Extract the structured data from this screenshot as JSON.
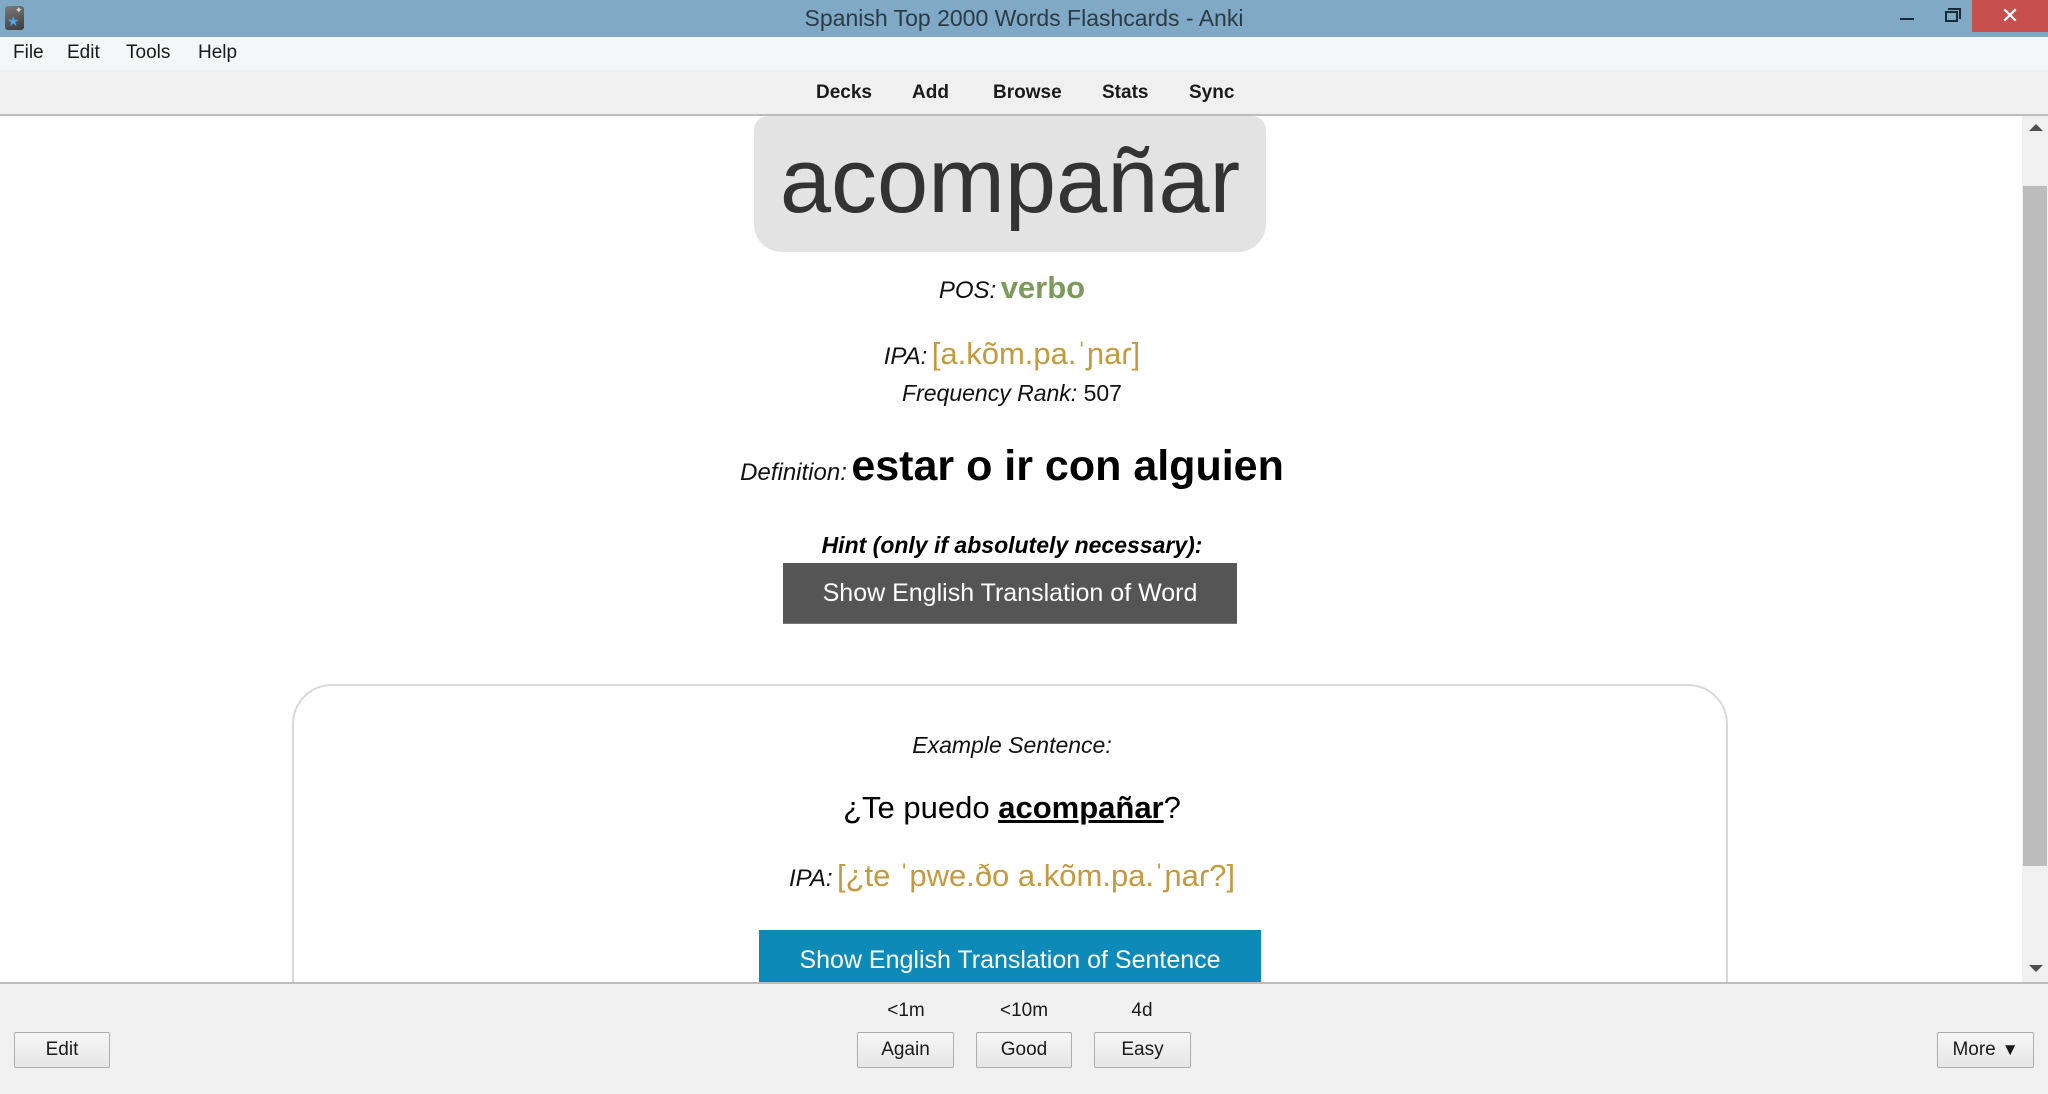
{
  "window": {
    "title": "Spanish Top 2000 Words Flashcards - Anki",
    "icon": "anki-star-icon",
    "controls": {
      "minimize": "minimize-icon",
      "restore": "restore-icon",
      "close": "close-icon",
      "close_glyph": "✕"
    },
    "close_color": "#c7504e",
    "titlebar_color": "#80a9c6"
  },
  "menu": {
    "items": [
      {
        "label": "File"
      },
      {
        "label": "Edit"
      },
      {
        "label": "Tools"
      },
      {
        "label": "Help"
      }
    ]
  },
  "toolbar": {
    "links": [
      {
        "label": "Decks"
      },
      {
        "label": "Add"
      },
      {
        "label": "Browse"
      },
      {
        "label": "Stats"
      },
      {
        "label": "Sync"
      }
    ]
  },
  "card": {
    "word": "acompañar",
    "pos": {
      "label": "POS:",
      "value": "verbo",
      "color": "#7c9a5b"
    },
    "ipa": {
      "label": "IPA:",
      "value": "[a.kõm.pa.ˈɲaɾ]",
      "color": "#c59a3e"
    },
    "frequency": {
      "label": "Frequency Rank:",
      "value": "507"
    },
    "definition": {
      "label": "Definition:",
      "value": "estar o ir con alguien"
    },
    "hint": {
      "label": "Hint (only if absolutely necessary):",
      "button": "Show English Translation of Word",
      "button_color": "#555555"
    },
    "example": {
      "label": "Example Sentence:",
      "sentence_before": "¿Te puedo ",
      "sentence_highlight": "acompañar",
      "sentence_after": "?",
      "ipa_label": "IPA:",
      "ipa_value": "[¿te ˈpwe.ðo a.kõm.pa.ˈɲaɾ?]",
      "button": "Show English Translation of Sentence",
      "button_color": "#0e8ab8"
    }
  },
  "scrollbar": {
    "up": "scroll-up-arrow-icon",
    "down": "scroll-down-arrow-icon"
  },
  "bottom": {
    "edit_button": "Edit",
    "answers": [
      {
        "label": "Again",
        "interval": "<1m"
      },
      {
        "label": "Good",
        "interval": "<10m"
      },
      {
        "label": "Easy",
        "interval": "4d"
      }
    ],
    "more_button": "More",
    "more_arrow": "▼"
  }
}
